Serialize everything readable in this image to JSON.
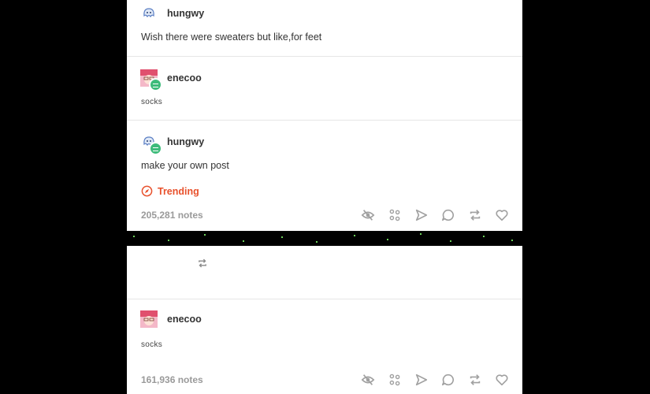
{
  "posts": [
    {
      "username": "hungwy",
      "text": "Wish there were sweaters but like,for feet"
    },
    {
      "username": "enecoo",
      "text": "socks"
    },
    {
      "username": "hungwy",
      "text": "make your own post"
    }
  ],
  "trending_label": "Trending",
  "post1_notes": "205,281 notes",
  "post2": {
    "username": "enecoo",
    "text": "socks",
    "notes": "161,936 notes"
  },
  "colors": {
    "accent_trending": "#e8512c",
    "badge": "#3dbb7a",
    "notes": "#9a9a9a"
  },
  "icons": [
    "eye-slash-icon",
    "community-icon",
    "share-icon",
    "reply-icon",
    "reblog-icon",
    "heart-icon"
  ]
}
